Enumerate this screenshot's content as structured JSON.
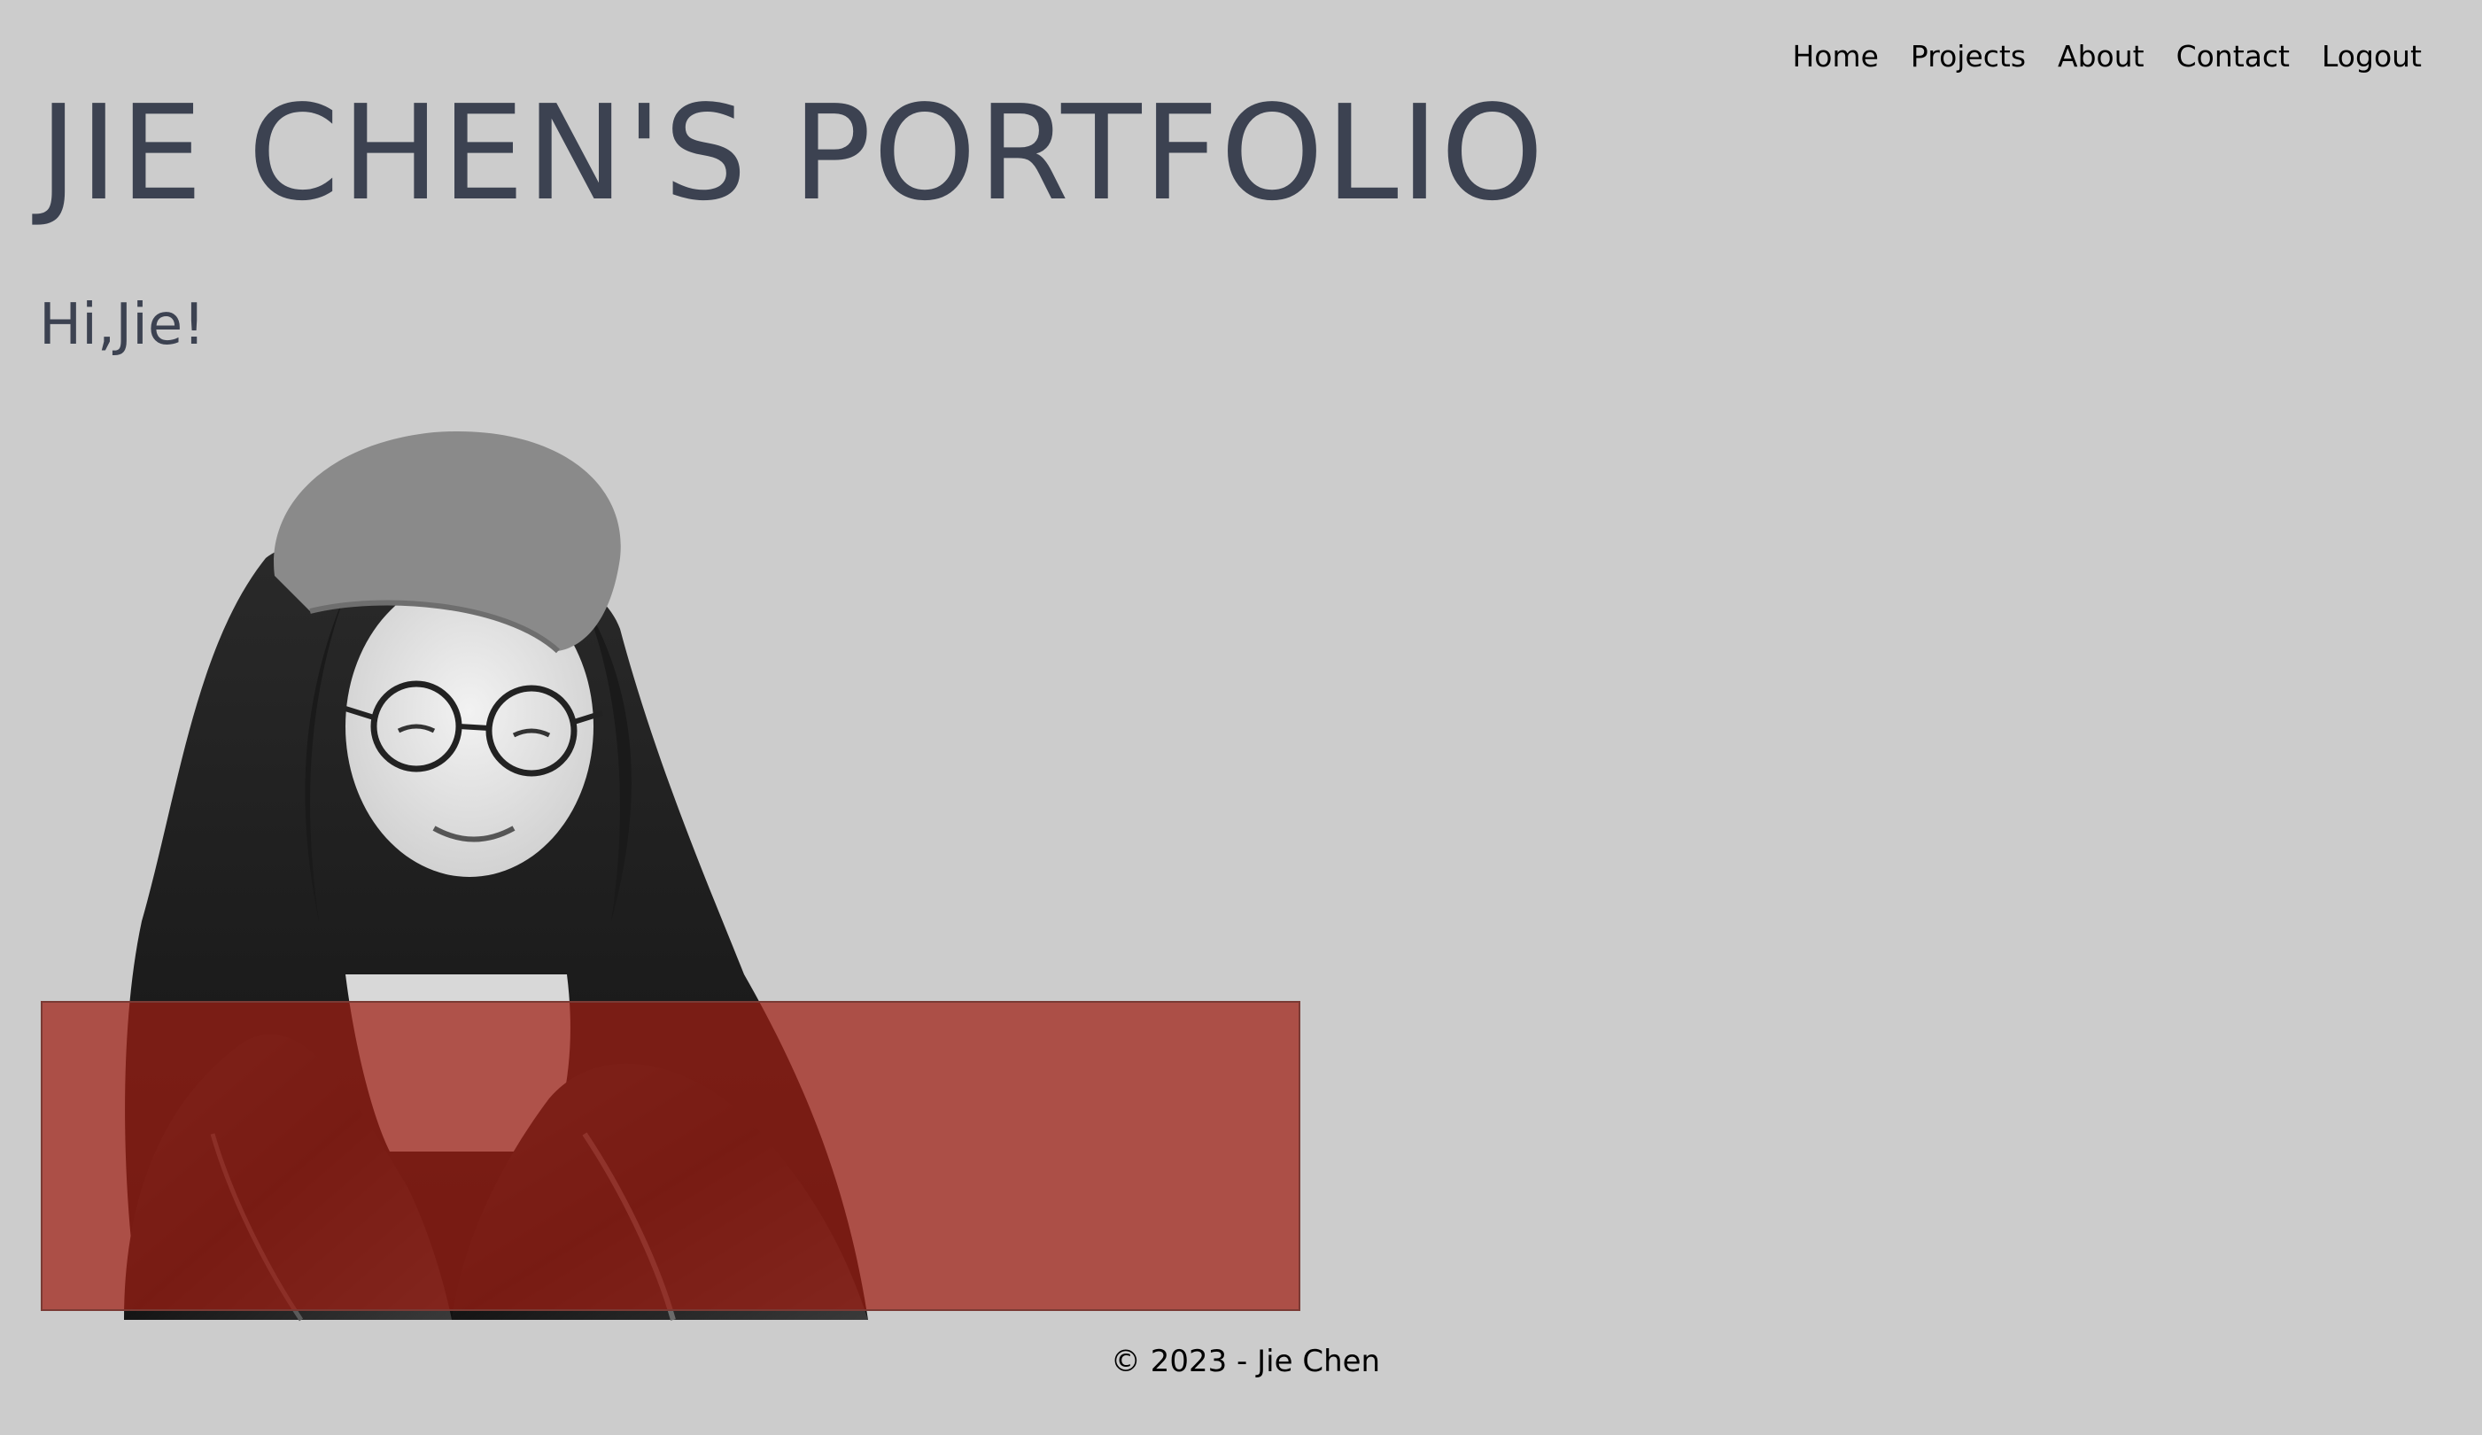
{
  "nav": {
    "items": [
      {
        "label": "Home"
      },
      {
        "label": "Projects"
      },
      {
        "label": "About"
      },
      {
        "label": "Contact"
      },
      {
        "label": "Logout"
      }
    ]
  },
  "header": {
    "title": "JIE CHEN'S PORTFOLIO",
    "greeting": "Hi,Jie!"
  },
  "hero": {
    "image": "black-and-white portrait photo of Jie Chen wearing a beret, glasses and leather jacket",
    "overlay_color": "#a01e14"
  },
  "footer": {
    "text": "© 2023 - Jie Chen"
  },
  "colors": {
    "background": "#cccccc",
    "heading": "#3c4251"
  }
}
